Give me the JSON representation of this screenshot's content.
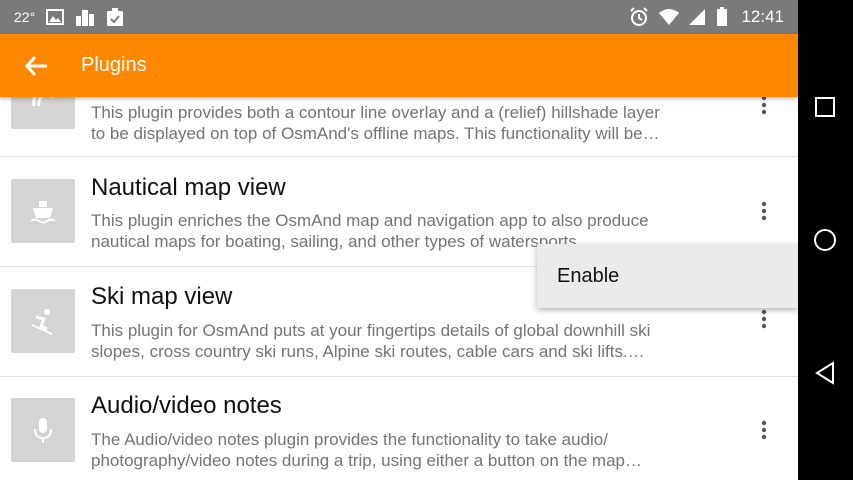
{
  "status_bar": {
    "temperature": "22°",
    "time": "12:41",
    "icons": [
      "image-icon",
      "city-icon",
      "clipboard-check-icon",
      "alarm-icon",
      "wifi-icon",
      "signal-icon",
      "battery-icon"
    ]
  },
  "toolbar": {
    "back_icon": "arrow-back-icon",
    "title": "Plugins",
    "background": "#ff8800"
  },
  "plugins": [
    {
      "title": "",
      "icon": "contour-icon",
      "desc_line1": "This plugin provides both a contour line overlay and a (relief) hillshade layer",
      "desc_line2": "to be displayed on top of OsmAnd's offline maps. This functionality will be…"
    },
    {
      "title": "Nautical map view",
      "icon": "ship-icon",
      "desc_line1": "This plugin enriches the OsmAnd map and navigation app to also produce",
      "desc_line2": "nautical maps for boating, sailing, and other types of watersports."
    },
    {
      "title": "Ski map view",
      "icon": "skier-icon",
      "desc_line1": "This plugin for OsmAnd puts at your fingertips details of global downhill ski",
      "desc_line2": "slopes, cross country ski runs, Alpine ski routes, cable cars and ski lifts.…"
    },
    {
      "title": "Audio/video notes",
      "icon": "microphone-icon",
      "desc_line1": "The Audio/video notes plugin provides the functionality to take audio/",
      "desc_line2": "photography/video notes during a trip, using either a button on the map…"
    }
  ],
  "popup_menu": {
    "items": [
      "Enable"
    ]
  },
  "nav_bar": {
    "icons": [
      "recents-square-icon",
      "home-circle-icon",
      "back-triangle-icon"
    ]
  }
}
